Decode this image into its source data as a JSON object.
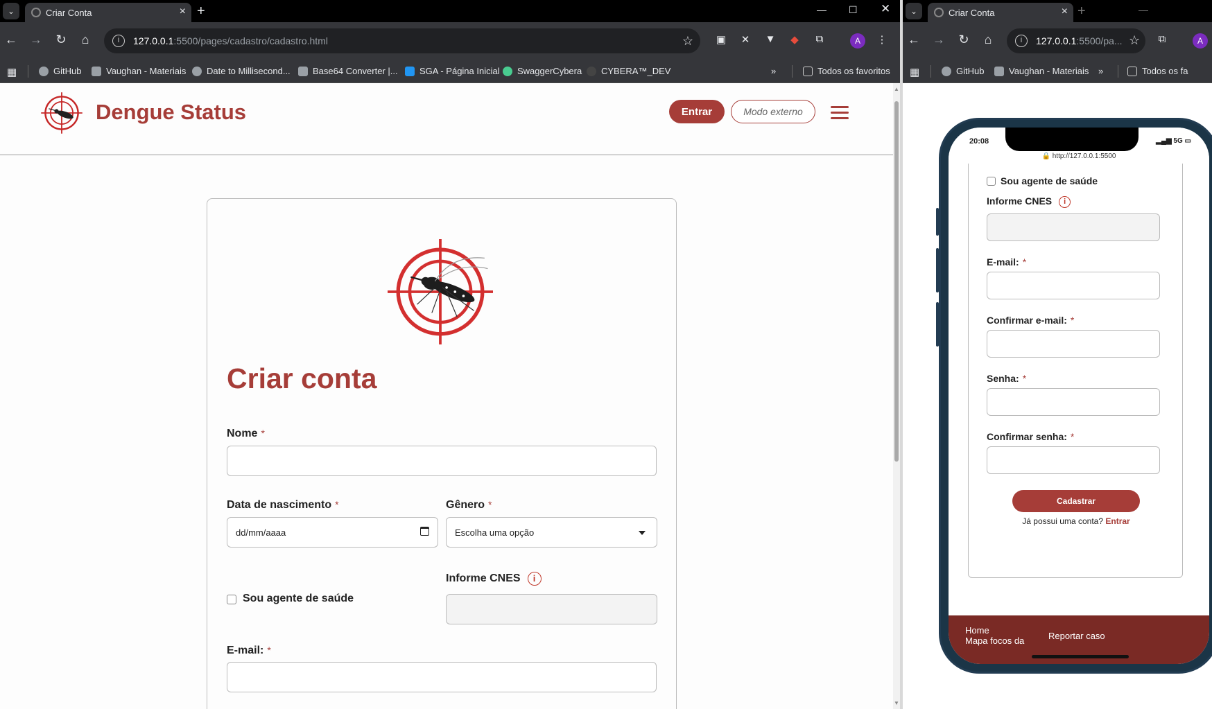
{
  "browser_main": {
    "tab_title": "Criar Conta",
    "url_host": "127.0.0.1",
    "url_path": ":5500/pages/cadastro/cadastro.html",
    "bookmarks": [
      "GitHub",
      "Vaughan - Materiais",
      "Date to Millisecond...",
      "Base64 Converter |...",
      "SGA - Página Inicial",
      "SwaggerCybera",
      "CYBERA™_DEV"
    ],
    "favorites_folder": "Todos os favoritos",
    "profile_initial": "A"
  },
  "browser_side": {
    "tab_title": "Criar Conta",
    "url_host": "127.0.0.1",
    "url_path": ":5500/pa...",
    "bookmarks": [
      "GitHub",
      "Vaughan - Materiais"
    ],
    "favorites_folder": "Todos os fa",
    "profile_initial": "A"
  },
  "site": {
    "brand": "Dengue Status",
    "login_button": "Entrar",
    "external_mode_button": "Modo externo"
  },
  "form": {
    "title": "Criar conta",
    "name_label": "Nome",
    "birth_label": "Data de nascimento",
    "birth_placeholder": "dd/mm/aaaa",
    "gender_label": "Gênero",
    "gender_value": "Escolha uma opção",
    "agent_checkbox_label": "Sou agente de saúde",
    "cnes_label": "Informe CNES",
    "email_label": "E-mail:",
    "required_mark": "*"
  },
  "phone": {
    "time": "20:08",
    "network": "5G",
    "url": "http://127.0.0.1:5500",
    "agent_checkbox_label": "Sou agente de saúde",
    "cnes_label": "Informe CNES",
    "email_label": "E-mail:",
    "confirm_email_label": "Confirmar e-mail:",
    "password_label": "Senha:",
    "confirm_password_label": "Confirmar senha:",
    "submit_button": "Cadastrar",
    "login_prompt": "Já possui uma conta?",
    "login_link": "Entrar",
    "footer_links": [
      "Home",
      "Mapa focos da",
      "Reportar caso"
    ]
  },
  "colors": {
    "brand_red": "#a63d38",
    "footer_red": "#7a2a25"
  }
}
